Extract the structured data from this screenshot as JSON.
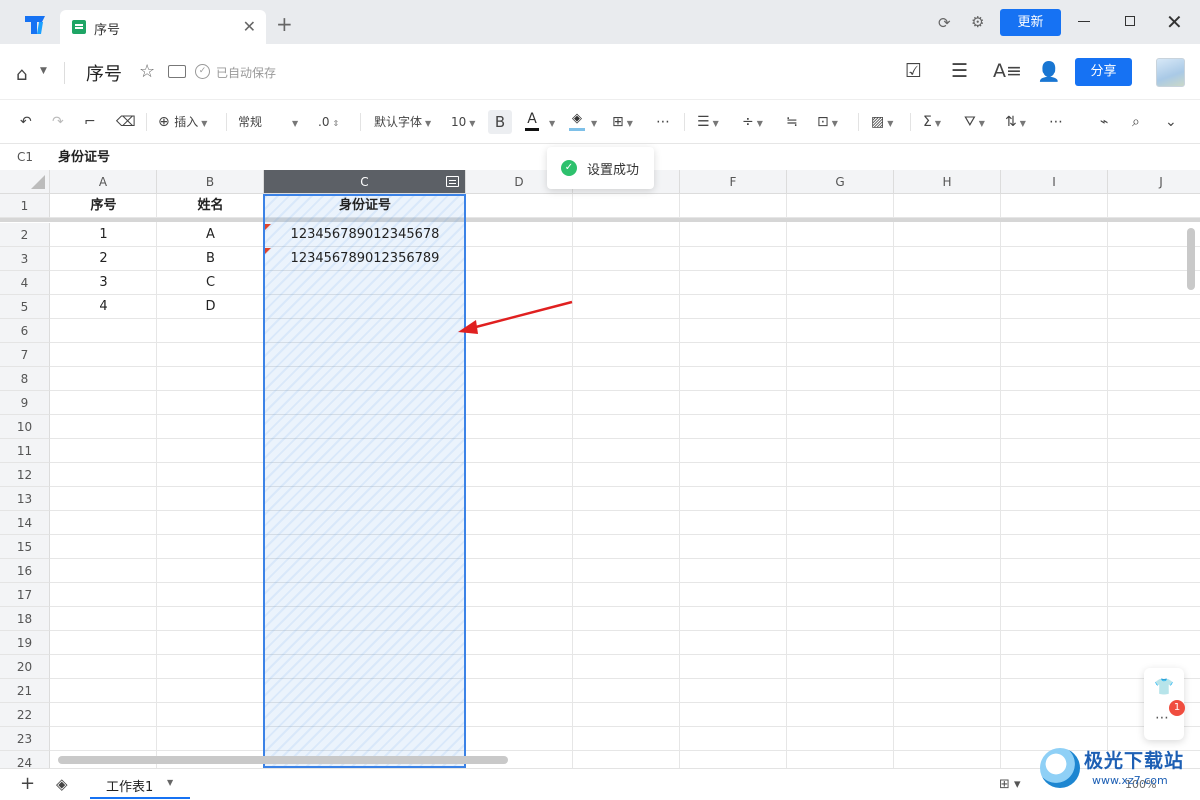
{
  "titlebar": {
    "tab_title": "序号",
    "tab_close": "✕",
    "new_tab": "+",
    "update_label": "更新"
  },
  "header": {
    "doc_title": "序号",
    "save_status": "已自动保存",
    "share_label": "分享"
  },
  "toolbar": {
    "insert_label": "插入",
    "format_value": "常规",
    "decimal_label": ".0",
    "font_family": "默认字体",
    "font_size": "10",
    "bold_label": "B",
    "font_color_label": "A"
  },
  "formula_bar": {
    "cell_ref": "C1",
    "value": "身份证号"
  },
  "toast": {
    "text": "设置成功"
  },
  "grid": {
    "columns": [
      "A",
      "B",
      "C",
      "D",
      "E",
      "F",
      "G",
      "H",
      "I",
      "J"
    ],
    "selected_column": "C",
    "rows": [
      "1",
      "2",
      "3",
      "4",
      "5",
      "6",
      "7",
      "8",
      "9",
      "10",
      "11",
      "12",
      "13",
      "14",
      "15",
      "16",
      "17",
      "18",
      "19",
      "20",
      "21",
      "22",
      "23",
      "24"
    ],
    "cells": {
      "A1": "序号",
      "B1": "姓名",
      "C1": "身份证号",
      "A2": "1",
      "B2": "A",
      "C2": "123456789012345678",
      "A3": "2",
      "B3": "B",
      "C3": "123456789012356789",
      "A4": "3",
      "B4": "C",
      "A5": "4",
      "B5": "D"
    }
  },
  "side_panel": {
    "notification_count": "1"
  },
  "bottombar": {
    "add_sheet": "+",
    "sheet_tab": "工作表1",
    "zoom": "100%"
  },
  "watermark": {
    "title": "极光下载站",
    "subtitle": "www.xz7.com"
  },
  "colors": {
    "accent": "#1672f3",
    "selection": "#3b82e6",
    "success": "#2ec16d",
    "annotation_arrow": "#e02020",
    "error_marker": "#e0442c"
  }
}
